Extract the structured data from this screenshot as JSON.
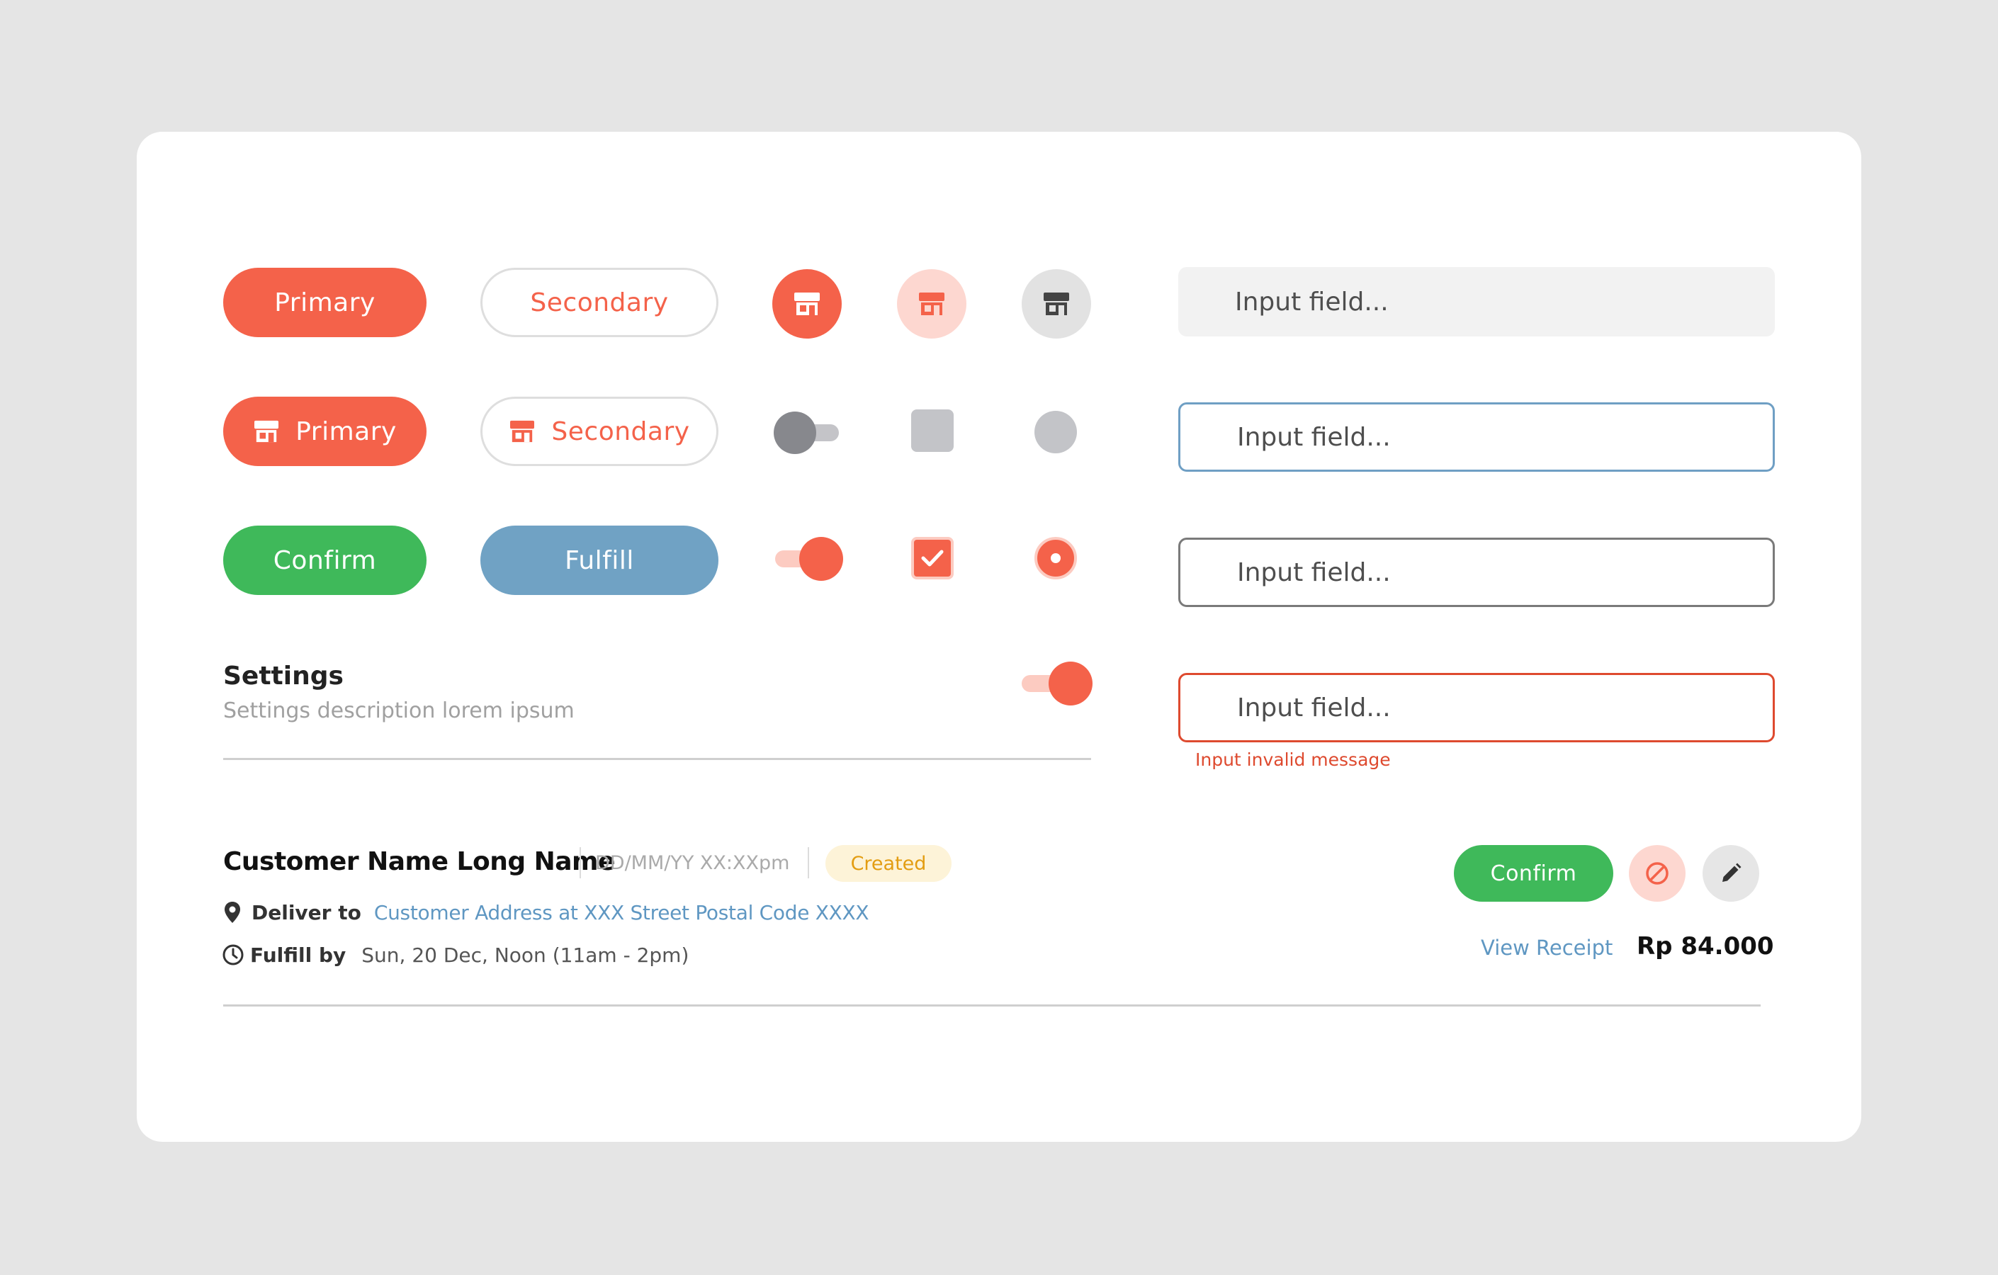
{
  "colors": {
    "primary": "#f4624a",
    "confirm": "#3fb95a",
    "fulfill": "#70a2c4",
    "link": "#5f97c2",
    "error": "#de4a2f",
    "badge_bg": "#fdf3d8",
    "badge_text": "#e39d12"
  },
  "buttons": {
    "primary_label": "Primary",
    "secondary_label": "Secondary",
    "primary_icon_label": "Primary",
    "secondary_icon_label": "Secondary",
    "confirm_label": "Confirm",
    "fulfill_label": "Fulfill",
    "icon": "store-icon"
  },
  "controls": {
    "toggle_off": false,
    "toggle_on": true,
    "checkbox_unchecked": false,
    "checkbox_checked": true,
    "radio_unselected": false,
    "radio_selected": true
  },
  "inputs": [
    {
      "placeholder": "Input field...",
      "state": "default"
    },
    {
      "placeholder": "Input field...",
      "state": "focused"
    },
    {
      "placeholder": "Input field...",
      "state": "filled"
    },
    {
      "placeholder": "Input field...",
      "state": "error",
      "error_message": "Input invalid message"
    }
  ],
  "settings": {
    "title": "Settings",
    "description": "Settings description lorem ipsum",
    "toggle_on": true
  },
  "order": {
    "customer_name": "Customer Name Long Name",
    "datetime": "DD/MM/YY XX:XXpm",
    "status": "Created",
    "deliver_label": "Deliver to",
    "address": "Customer Address at XXX Street Postal Code XXXX",
    "fulfill_label": "Fulfill by",
    "fulfill_time": "Sun, 20 Dec, Noon (11am - 2pm)",
    "confirm_label": "Confirm",
    "view_receipt": "View Receipt",
    "price": "Rp 84.000",
    "cancel_icon": "block-icon",
    "edit_icon": "pencil-icon",
    "pin_icon": "location-pin-icon",
    "clock_icon": "clock-icon"
  }
}
